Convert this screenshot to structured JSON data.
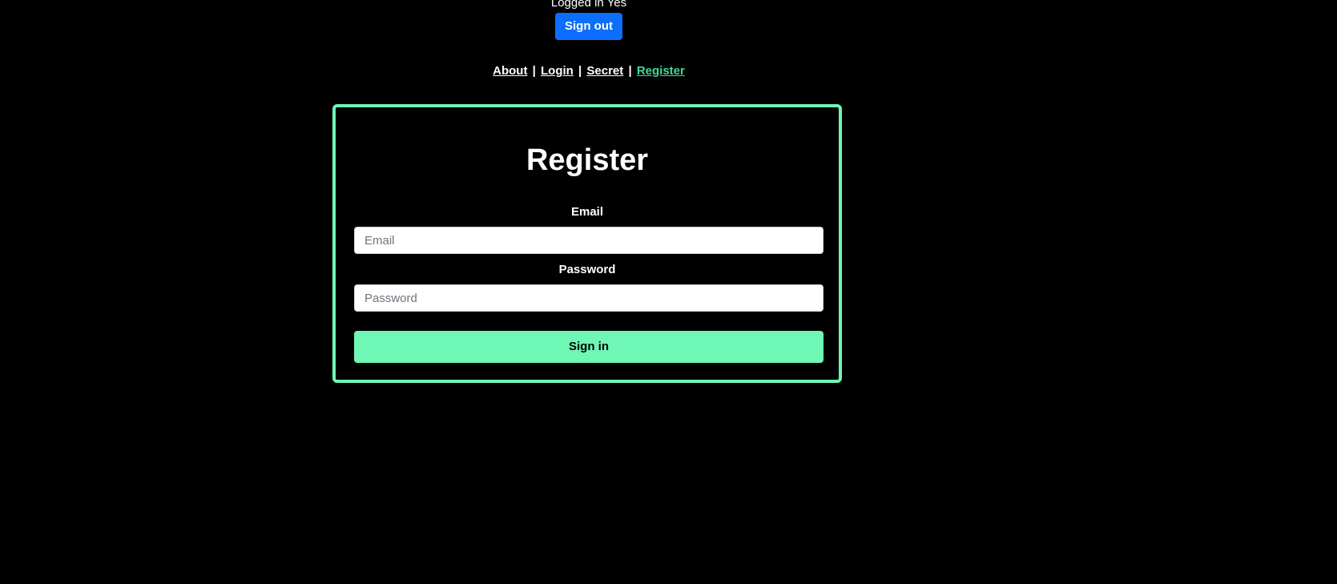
{
  "header": {
    "status_text": "Logged in Yes",
    "signout_label": "Sign out"
  },
  "nav": {
    "separator": "|",
    "items": [
      {
        "label": "About",
        "active": false
      },
      {
        "label": "Login",
        "active": false
      },
      {
        "label": "Secret",
        "active": false
      },
      {
        "label": "Register",
        "active": true
      }
    ]
  },
  "form": {
    "title": "Register",
    "email_label": "Email",
    "email_placeholder": "Email",
    "email_value": "",
    "password_label": "Password",
    "password_placeholder": "Password",
    "password_value": "",
    "submit_label": "Sign in"
  },
  "colors": {
    "background": "#000000",
    "accent": "#6ef7b5",
    "active_link": "#3ddc97",
    "primary_button": "#0d6efd"
  }
}
